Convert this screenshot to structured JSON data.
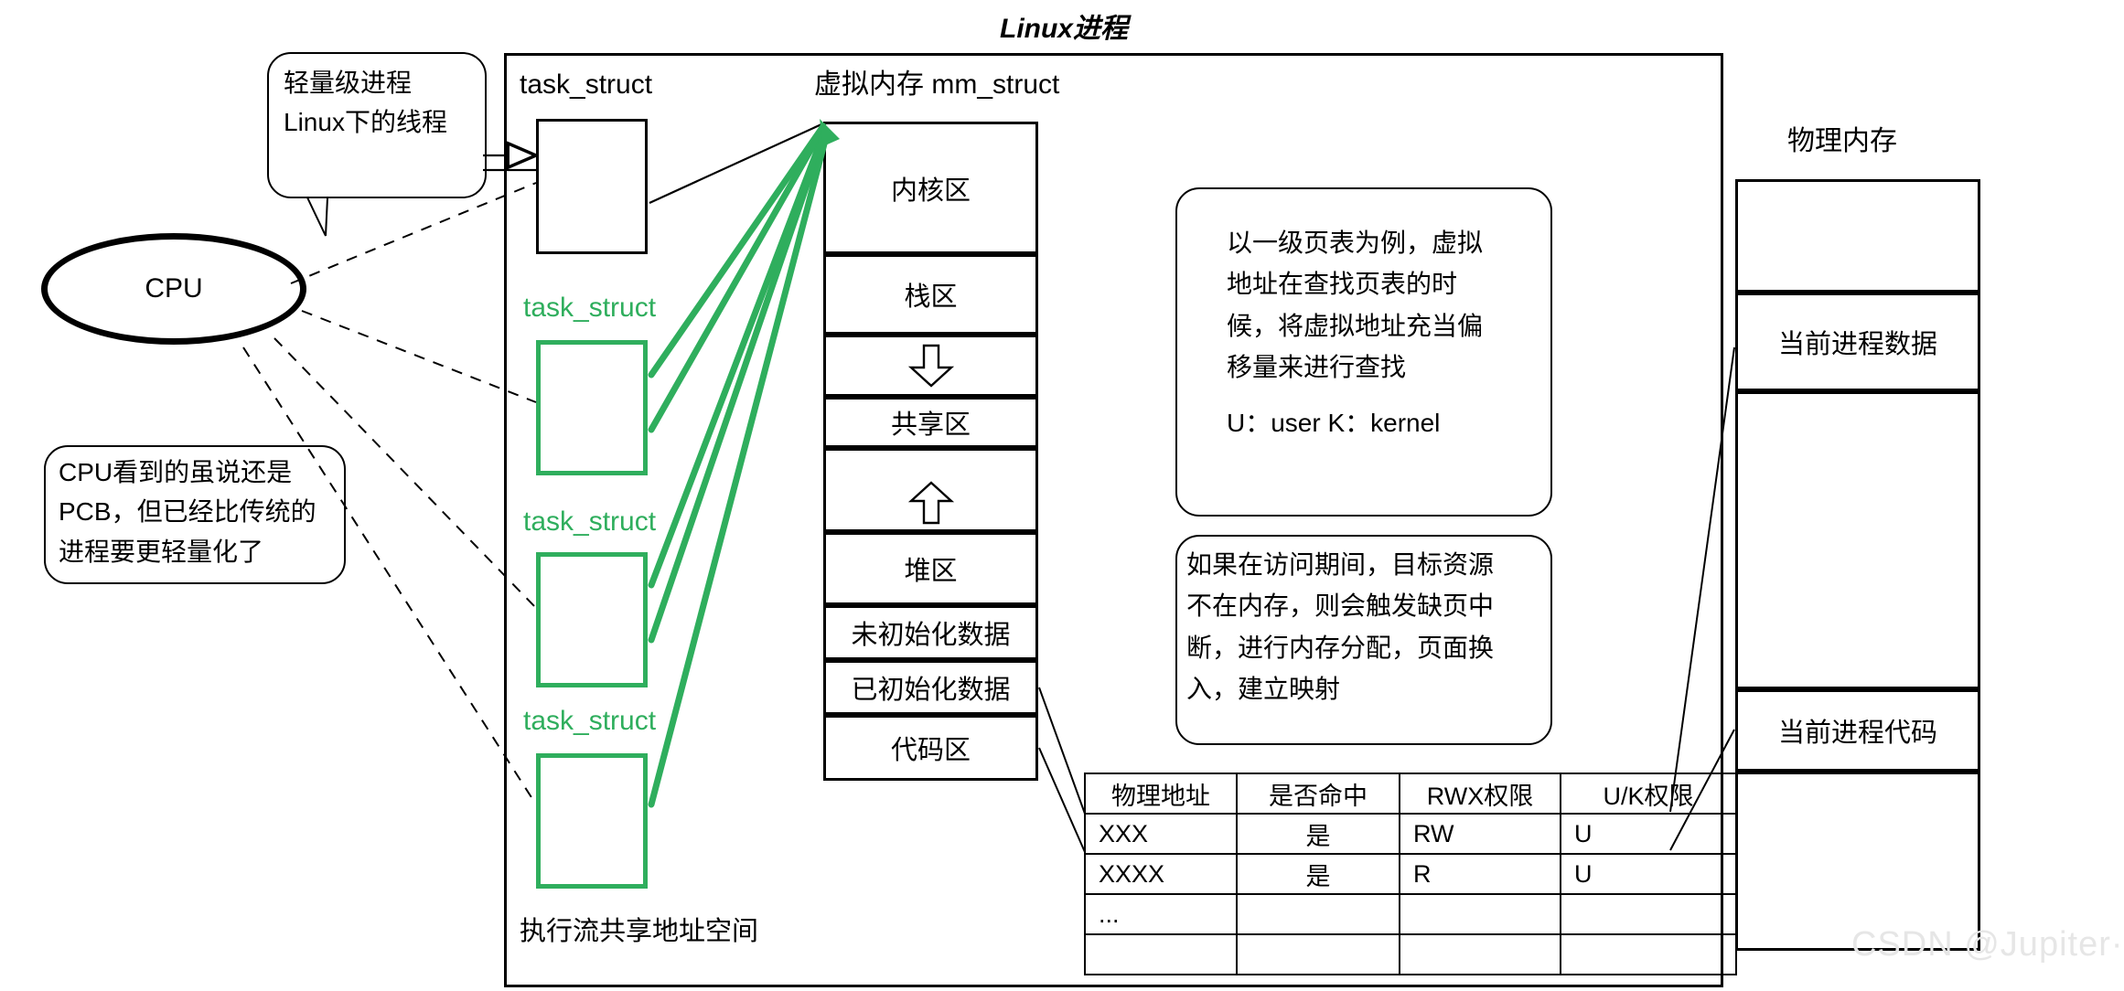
{
  "title": "Linux进程",
  "watermark": "CSDN @Jupiter·",
  "cpu": {
    "label": "CPU"
  },
  "callouts": [
    {
      "name": "lightweight-process",
      "lines": [
        "轻量级进程",
        "Linux下的线程"
      ]
    },
    {
      "name": "cpu-pcb-note",
      "lines": [
        "CPU看到的虽说还是",
        "PCB，但已经比传统的",
        "进程要更轻量化了"
      ]
    }
  ],
  "task_structs": [
    {
      "label": "task_struct",
      "color": "#000000"
    },
    {
      "label": "task_struct",
      "color": "#2fae5d"
    },
    {
      "label": "task_struct",
      "color": "#2fae5d"
    },
    {
      "label": "task_struct",
      "color": "#2fae5d"
    }
  ],
  "shared_address_note": "执行流共享地址空间",
  "virtual_memory": {
    "header": "虚拟内存 mm_struct",
    "segments": [
      {
        "label": "内核区",
        "kind": "text"
      },
      {
        "label": "栈区",
        "kind": "text"
      },
      {
        "label": "",
        "kind": "arrow-down"
      },
      {
        "label": "共享区",
        "kind": "text"
      },
      {
        "label": "",
        "kind": "arrow-up"
      },
      {
        "label": "堆区",
        "kind": "text"
      },
      {
        "label": "未初始化数据",
        "kind": "text"
      },
      {
        "label": "已初始化数据",
        "kind": "text"
      },
      {
        "label": "代码区",
        "kind": "text"
      }
    ]
  },
  "notes": [
    {
      "name": "page-table-note",
      "lines": [
        "以一级页表为例，虚拟",
        "地址在查找页表的时",
        "候，将虚拟地址充当偏",
        "移量来进行查找"
      ],
      "footer": "U：user  K：kernel"
    },
    {
      "name": "page-fault-note",
      "lines": [
        "如果在访问期间，目标资源",
        "不在内存，则会触发缺页中",
        "断，进行内存分配，页面换",
        "入，建立映射"
      ],
      "footer": ""
    }
  ],
  "page_table": {
    "headers": [
      "物理地址",
      "是否命中",
      "RWX权限",
      "U/K权限"
    ],
    "rows": [
      [
        "XXX",
        "是",
        "RW",
        "U"
      ],
      [
        "XXXX",
        "是",
        "R",
        "U"
      ],
      [
        "...",
        "",
        "",
        ""
      ],
      [
        "",
        "",
        "",
        ""
      ]
    ]
  },
  "physical_memory": {
    "header": "物理内存",
    "segments": [
      {
        "label": ""
      },
      {
        "label": "当前进程数据"
      },
      {
        "label": ""
      },
      {
        "label": "当前进程代码"
      },
      {
        "label": ""
      }
    ]
  },
  "colors": {
    "green": "#2fae5d",
    "black": "#000000",
    "watermark": "#e6e6e6"
  }
}
